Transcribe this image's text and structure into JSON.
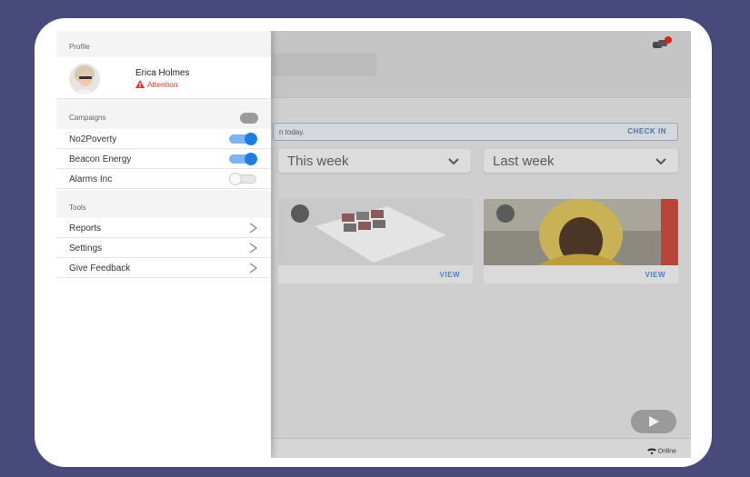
{
  "drawer": {
    "profile_header": "Profile",
    "user": {
      "name": "Erica Holmes",
      "status": "Attention"
    },
    "campaigns_header": "Campaigns",
    "campaigns": [
      {
        "label": "No2Poverty",
        "enabled": true
      },
      {
        "label": "Beacon Energy",
        "enabled": true
      },
      {
        "label": "Alarms Inc",
        "enabled": false
      }
    ],
    "tools_header": "Tools",
    "tools": [
      {
        "label": "Reports"
      },
      {
        "label": "Settings"
      },
      {
        "label": "Give Feedback"
      }
    ]
  },
  "app": {
    "checkin_text": "n today.",
    "checkin_button": "CHECK IN",
    "period_selects": [
      "This week",
      "Last week"
    ],
    "cards": [
      {
        "action": "VIEW"
      },
      {
        "action": "VIEW"
      }
    ],
    "network_status": "Online"
  },
  "colors": {
    "background": "#474a7b",
    "toggle_on": "#1f7fe1",
    "attention": "#e0342c",
    "link": "#3f77b8"
  }
}
